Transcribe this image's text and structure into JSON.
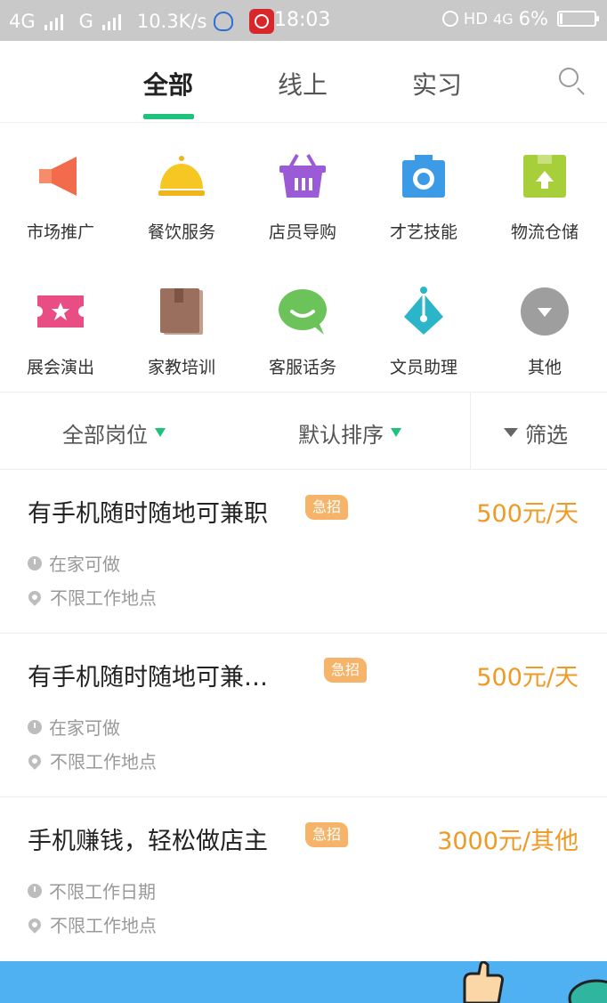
{
  "status_bar": {
    "network1": "4G",
    "network2": "G",
    "speed": "10.3K/s",
    "time": "18:03",
    "hd_label": "HD",
    "network3": "4G",
    "battery": "6%"
  },
  "tabs": [
    {
      "label": "全部",
      "active": true
    },
    {
      "label": "线上",
      "active": false
    },
    {
      "label": "实习",
      "active": false
    }
  ],
  "categories": [
    {
      "label": "市场推广",
      "icon": "megaphone-icon",
      "color": "#f26b4c"
    },
    {
      "label": "餐饮服务",
      "icon": "food-cloche-icon",
      "color": "#f6c623"
    },
    {
      "label": "店员导购",
      "icon": "shopping-basket-icon",
      "color": "#9b5bd6"
    },
    {
      "label": "才艺技能",
      "icon": "camera-icon",
      "color": "#3b9be6"
    },
    {
      "label": "物流仓储",
      "icon": "package-box-icon",
      "color": "#a6cf39"
    },
    {
      "label": "展会演出",
      "icon": "ticket-star-icon",
      "color": "#e84d84"
    },
    {
      "label": "家教培训",
      "icon": "book-icon",
      "color": "#9b6f5d"
    },
    {
      "label": "客服话务",
      "icon": "chat-bubble-icon",
      "color": "#6cc35a"
    },
    {
      "label": "文员助理",
      "icon": "pen-nib-icon",
      "color": "#2cb5c9"
    },
    {
      "label": "其他",
      "icon": "dropdown-circle-icon",
      "color": "#9e9e9e"
    }
  ],
  "filters": {
    "position": "全部岗位",
    "sort": "默认排序",
    "filter": "筛选"
  },
  "jobs": [
    {
      "title": "有手机随时随地可兼职",
      "tag": "急招",
      "salary": "500元/天",
      "date": "在家可做",
      "location": "不限工作地点"
    },
    {
      "title": "有手机随时随地可兼…",
      "tag": "急招",
      "salary": "500元/天",
      "date": "在家可做",
      "location": "不限工作地点"
    },
    {
      "title": "手机赚钱，轻松做店主",
      "tag": "急招",
      "salary": "3000元/其他",
      "date": "不限工作日期",
      "location": "不限工作地点"
    }
  ],
  "colors": {
    "accent": "#1fc27a",
    "salary": "#ee9a25",
    "urgent_tag": "#f5b469",
    "banner": "#4fb0f2"
  }
}
